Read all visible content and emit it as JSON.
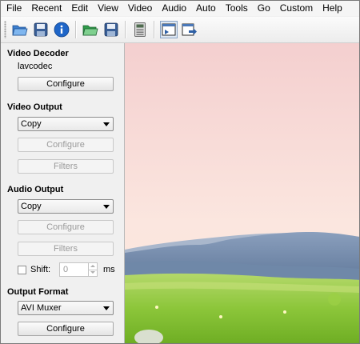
{
  "menu": [
    "File",
    "Recent",
    "Edit",
    "View",
    "Video",
    "Audio",
    "Auto",
    "Tools",
    "Go",
    "Custom",
    "Help"
  ],
  "toolbar": {
    "buttons": [
      {
        "icon": "open-folder-icon"
      },
      {
        "icon": "save-disk-icon"
      },
      {
        "icon": "info-icon"
      },
      {
        "icon": "open-folder-green-icon"
      },
      {
        "icon": "save-disk-2-icon"
      },
      {
        "icon": "calculator-icon"
      },
      {
        "icon": "input-preview-icon"
      },
      {
        "icon": "output-preview-icon"
      }
    ]
  },
  "video_decoder": {
    "title": "Video Decoder",
    "decoder": "lavcodec",
    "configure": "Configure"
  },
  "video_output": {
    "title": "Video Output",
    "codec": "Copy",
    "configure": "Configure",
    "filters": "Filters"
  },
  "audio_output": {
    "title": "Audio Output",
    "codec": "Copy",
    "configure": "Configure",
    "filters": "Filters",
    "shift_label": "Shift:",
    "shift_value": "0",
    "shift_unit": "ms"
  },
  "output_format": {
    "title": "Output Format",
    "muxer": "AVI Muxer",
    "configure": "Configure"
  },
  "colors": {
    "sky_top": "#f6d6d6",
    "sky_bottom": "#fbe7df",
    "hills": "#6f86a4",
    "grass": "#8cc63a"
  }
}
